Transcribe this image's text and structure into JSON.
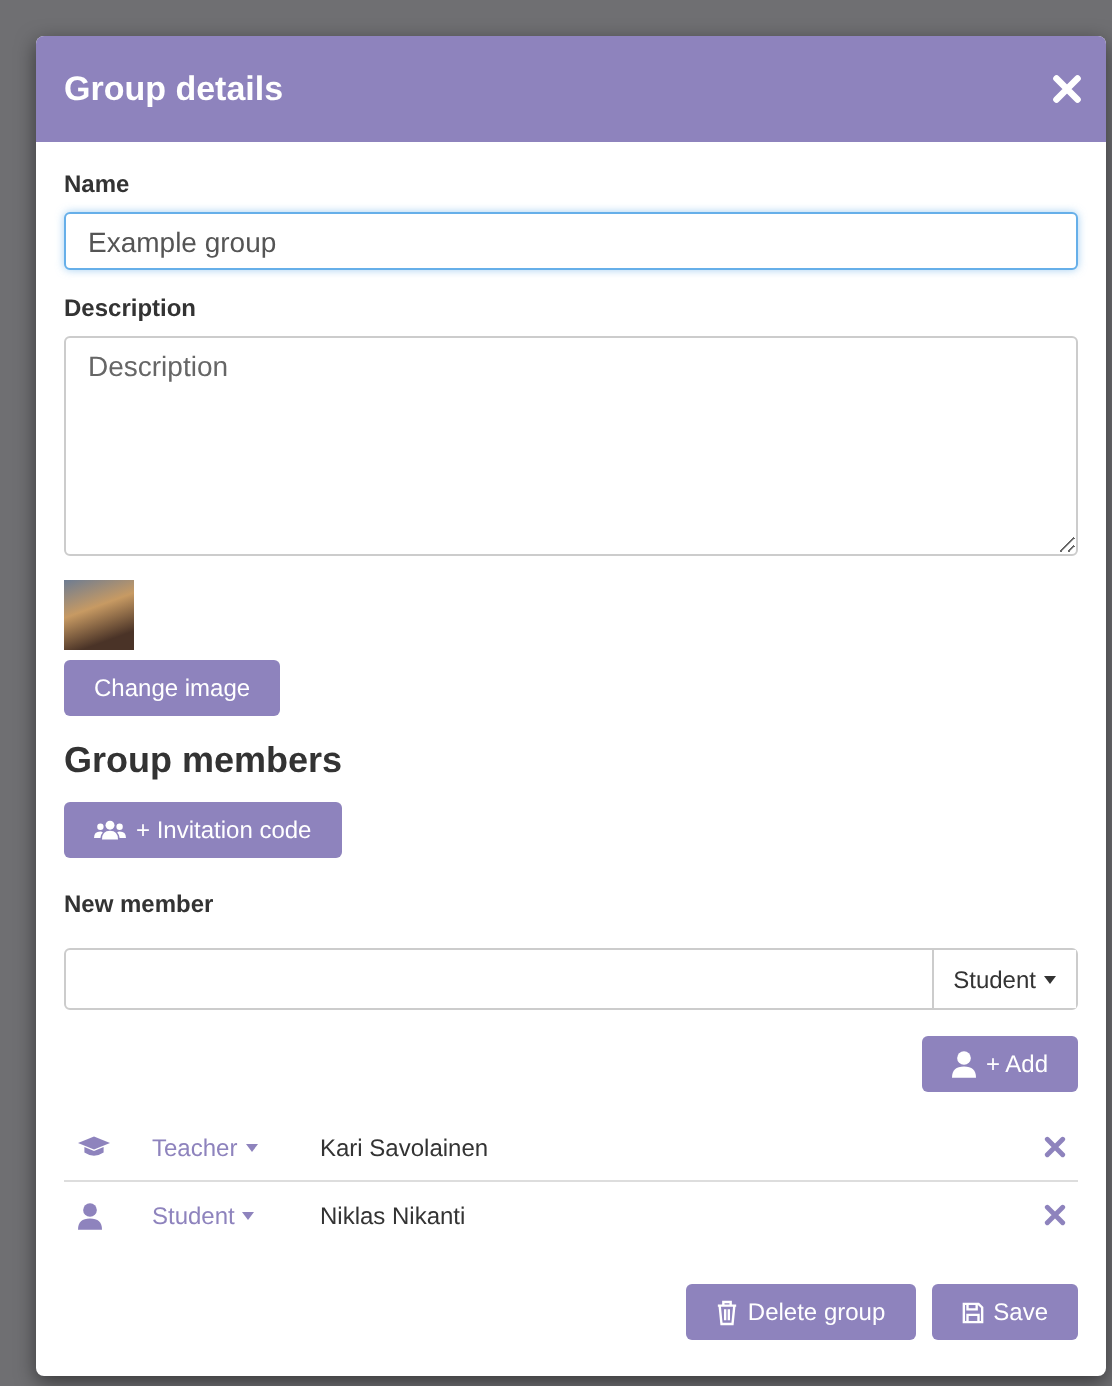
{
  "dialog": {
    "title": "Group details"
  },
  "name_field": {
    "label": "Name",
    "value": "Example group"
  },
  "description_field": {
    "label": "Description",
    "placeholder": "Description"
  },
  "image": {
    "button": "Change image"
  },
  "members_section": {
    "heading": "Group members",
    "invite_button": "+ Invitation code",
    "new_member_label": "New member",
    "role_select": "Student",
    "add_button": "+ Add"
  },
  "members": [
    {
      "kind": "teacher",
      "role": "Teacher",
      "name": "Kari Savolainen"
    },
    {
      "kind": "student",
      "role": "Student",
      "name": "Niklas Nikanti"
    }
  ],
  "footer": {
    "delete_button": "Delete group",
    "save_button": "Save"
  }
}
